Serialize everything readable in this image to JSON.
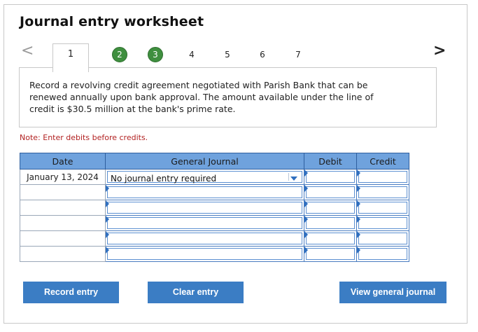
{
  "title": "Journal entry worksheet",
  "nav": {
    "prev_icon": "chevron-left-icon",
    "next_icon": "chevron-right-icon",
    "prev_glyph": "<",
    "next_glyph": ">",
    "steps": [
      {
        "label": "1",
        "state": "active"
      },
      {
        "label": "2",
        "state": "completed"
      },
      {
        "label": "3",
        "state": "completed"
      },
      {
        "label": "4",
        "state": "pending"
      },
      {
        "label": "5",
        "state": "pending"
      },
      {
        "label": "6",
        "state": "pending"
      },
      {
        "label": "7",
        "state": "pending"
      }
    ]
  },
  "question": "Record a revolving credit agreement negotiated with Parish Bank that can be renewed annually upon bank approval. The amount available under the line of credit is $30.5 million at the bank's prime rate.",
  "note": "Note: Enter debits before credits.",
  "journal": {
    "headers": {
      "date": "Date",
      "account": "General Journal",
      "debit": "Debit",
      "credit": "Credit"
    },
    "rows": [
      {
        "date": "January 13, 2024",
        "account": "No journal entry required",
        "debit": "",
        "credit": ""
      },
      {
        "date": "",
        "account": "",
        "debit": "",
        "credit": ""
      },
      {
        "date": "",
        "account": "",
        "debit": "",
        "credit": ""
      },
      {
        "date": "",
        "account": "",
        "debit": "",
        "credit": ""
      },
      {
        "date": "",
        "account": "",
        "debit": "",
        "credit": ""
      },
      {
        "date": "",
        "account": "",
        "debit": "",
        "credit": ""
      }
    ]
  },
  "buttons": {
    "record": "Record entry",
    "clear": "Clear entry",
    "view": "View general journal"
  },
  "colors": {
    "header_blue": "#6fa2dd",
    "button_blue": "#3b7dc4",
    "step_done_green": "#3f8f3f",
    "note_red": "#b22222"
  }
}
